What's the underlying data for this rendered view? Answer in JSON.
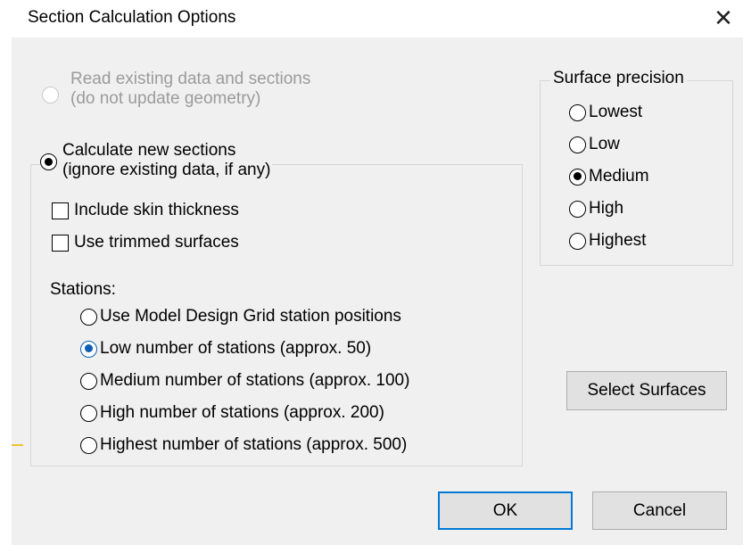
{
  "dialog": {
    "title": "Section Calculation Options",
    "close_glyph": "✕"
  },
  "read_existing": {
    "line1": "Read existing data and sections",
    "line2": "(do not update geometry)",
    "enabled": false,
    "checked": false
  },
  "calculate_new": {
    "line1": "Calculate new sections",
    "line2": "(ignore existing data, if any)",
    "checked": true
  },
  "options": {
    "include_skin_thickness": "Include skin thickness",
    "use_trimmed_surfaces": "Use trimmed surfaces"
  },
  "stations": {
    "label": "Stations:",
    "items": [
      {
        "label": "Use Model Design Grid station positions",
        "checked": false
      },
      {
        "label": "Low number of stations (approx. 50)",
        "checked": true
      },
      {
        "label": "Medium number of stations (approx. 100)",
        "checked": false
      },
      {
        "label": "High number of stations (approx. 200)",
        "checked": false
      },
      {
        "label": "Highest number of stations (approx. 500)",
        "checked": false
      }
    ]
  },
  "surface_precision": {
    "label": "Surface precision",
    "items": [
      {
        "label": "Lowest",
        "checked": false
      },
      {
        "label": "Low",
        "checked": false
      },
      {
        "label": "Medium",
        "checked": true
      },
      {
        "label": "High",
        "checked": false
      },
      {
        "label": "Highest",
        "checked": false
      }
    ]
  },
  "buttons": {
    "select_surfaces": "Select Surfaces",
    "ok": "OK",
    "cancel": "Cancel"
  },
  "colors": {
    "accent": "#0078d7",
    "selected_dot": "#0a5fb4",
    "disabled_text": "#9b9b9b"
  }
}
